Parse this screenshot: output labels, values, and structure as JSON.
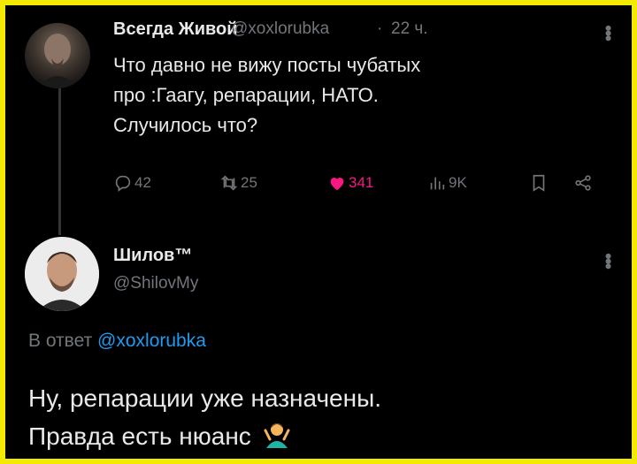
{
  "tweet1": {
    "author_name": "Всегда Живой",
    "author_handle": "@xoxlorubka",
    "separator": "·",
    "time": "22 ч.",
    "text_line1": "Что давно не вижу посты чубатых",
    "text_line2": "про :Гаагу, репарации, НАТО.",
    "text_line3": "Случилось что?",
    "actions": {
      "replies": "42",
      "retweets": "25",
      "likes": "341",
      "views": "9K"
    },
    "accent_like_color": "#f91880"
  },
  "tweet2": {
    "author_name": "Шилов™",
    "author_handle": "@ShilovMy",
    "reply_prefix": "В ответ",
    "reply_handle": "@xoxlorubka",
    "text_line1": "Ну, репарации уже назначены.",
    "text_line2": "Правда есть нюанс",
    "emoji": "person-shrugging-emoji"
  },
  "colors": {
    "background": "#000000",
    "border": "#f2ea00",
    "text_primary": "#e7e9ea",
    "text_secondary": "#71767b",
    "link": "#1d9bf0"
  }
}
